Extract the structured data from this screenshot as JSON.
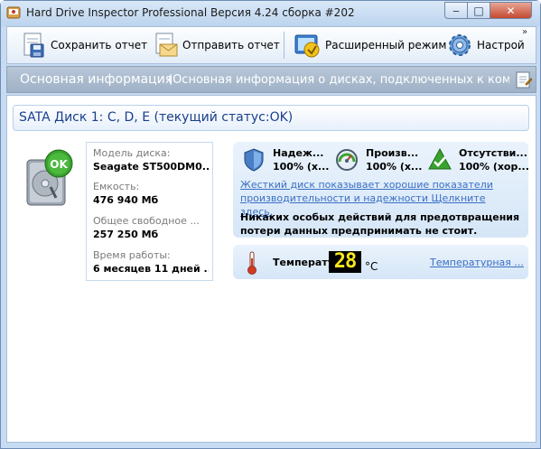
{
  "window": {
    "title": "Hard Drive Inspector Professional Версия 4.24 сборка #202",
    "controls": {
      "minimize": "‒",
      "maximize": "□",
      "close": "✕"
    }
  },
  "toolbar": {
    "save": "Сохранить отчет",
    "send": "Отправить отчет",
    "advanced": "Расширенный режим",
    "settings": "Настрой",
    "more": "»"
  },
  "infobar": {
    "title": "Основная информация",
    "description": "(Основная информация о дисках, подключенных к компьютер..."
  },
  "disk": {
    "header": "SATA Диск 1: C, D, E (текущий статус:OK)",
    "status_badge": "OK",
    "model_label": "Модель диска:",
    "model_value": "Seagate ST500DM0...",
    "capacity_label": "Емкость:",
    "capacity_value": "476 940 Мб",
    "free_label": "Общее свободное ...",
    "free_value": "257 250 Мб",
    "uptime_label": "Время работы:",
    "uptime_value": "6 месяцев 11 дней ..."
  },
  "status": {
    "reliability_title": "Надеж...",
    "reliability_value": "100% (х...",
    "performance_title": "Произв...",
    "performance_value": "100% (х...",
    "errors_title": "Отсутстви...",
    "errors_value": "100% (хор...",
    "hint_link": "Жесткий диск показывает хорошие показатели производительности и надежности Щелкните здесь.",
    "advice": "Никаких особых действий для предотвращения потери данных предпринимать не стоит."
  },
  "temperature": {
    "label": "Температура",
    "value": "28",
    "unit": "°C",
    "link": "Температурная ..."
  },
  "colors": {
    "accent": "#1a3f8b",
    "link": "#3b6fc4",
    "ok_green": "#3aa22f",
    "digits": "#f7e81b"
  }
}
